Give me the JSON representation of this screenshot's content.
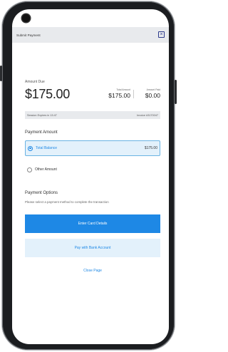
{
  "header": {
    "title": "Submit Payment",
    "close_icon": "close-icon"
  },
  "amount": {
    "label": "Amount Due",
    "value": "$175.00",
    "total_label": "Total Amount",
    "total_value": "$175.00",
    "paid_label": "Amount Paid",
    "paid_value": "$0.00"
  },
  "session": {
    "expires": "Session Expires in 13:47",
    "invoice": "Invoice #3170047"
  },
  "payment_amount": {
    "heading": "Payment Amount",
    "options": [
      {
        "label": "Total Balance",
        "value": "$175.00",
        "selected": true
      },
      {
        "label": "Other Amount",
        "value": "",
        "selected": false
      }
    ]
  },
  "payment_options": {
    "heading": "Payment Options",
    "description": "Please select a payment method to complete the transaction",
    "card_button": "Enter Card Details",
    "bank_button": "Pay with Bank Account"
  },
  "close_link": "Close Page",
  "colors": {
    "accent": "#1e88e5",
    "accent_light": "#e3f1fb",
    "bar_gray": "#e8eaed"
  }
}
